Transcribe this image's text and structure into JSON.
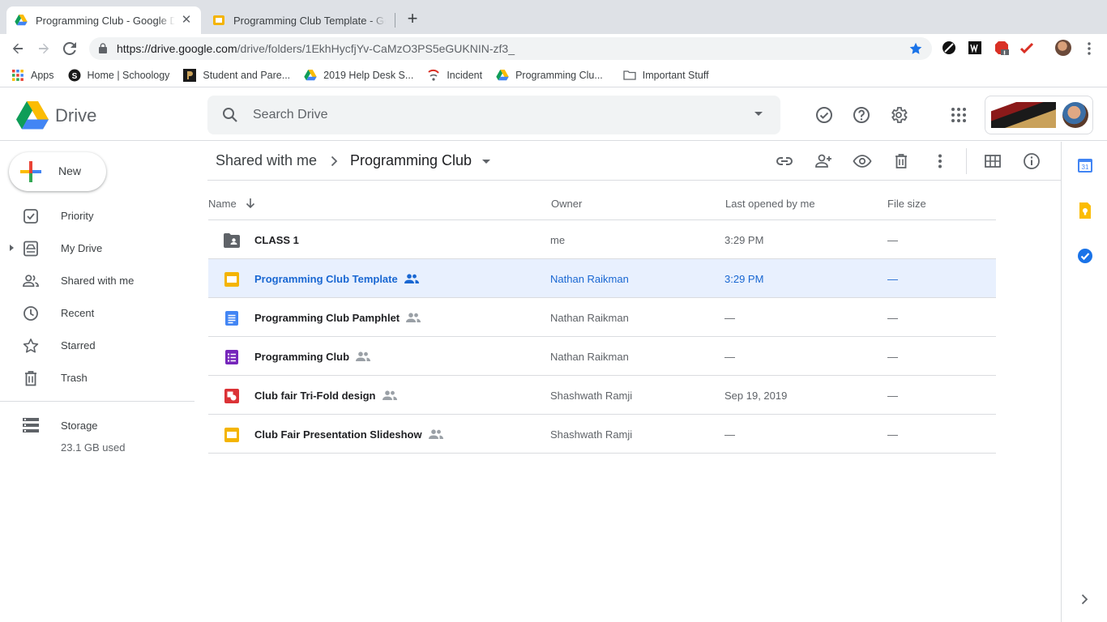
{
  "browser": {
    "tabs": [
      {
        "title": "Programming Club - Google Drive",
        "active": true
      },
      {
        "title": "Programming Club Template - Google Slides",
        "active": false
      }
    ],
    "url_host": "https://drive.google.com",
    "url_path": "/drive/folders/1EkhHycfjYv-CaMzO3PS5eGUKNIN-zf3_",
    "bookmarks": [
      "Apps",
      "Home | Schoology",
      "Student and Pare...",
      "2019 Help Desk S...",
      "Incident",
      "Programming Clu...",
      "Important Stuff"
    ]
  },
  "header": {
    "app_name": "Drive",
    "search_placeholder": "Search Drive"
  },
  "sidebar": {
    "new_label": "New",
    "items": [
      {
        "label": "Priority",
        "icon": "priority-icon"
      },
      {
        "label": "My Drive",
        "icon": "my-drive-icon"
      },
      {
        "label": "Shared with me",
        "icon": "shared-with-me-icon"
      },
      {
        "label": "Recent",
        "icon": "recent-icon"
      },
      {
        "label": "Starred",
        "icon": "star-icon"
      },
      {
        "label": "Trash",
        "icon": "trash-icon"
      }
    ],
    "storage_label": "Storage",
    "storage_used": "23.1 GB used"
  },
  "breadcrumb": {
    "parent": "Shared with me",
    "current": "Programming Club"
  },
  "table": {
    "columns": [
      "Name",
      "Owner",
      "Last opened by me",
      "File size"
    ],
    "rows": [
      {
        "name": "CLASS 1",
        "type": "shared-folder",
        "shared": false,
        "owner": "me",
        "last_opened": "3:29 PM",
        "size": "—",
        "selected": false
      },
      {
        "name": "Programming Club Template",
        "type": "slides",
        "shared": true,
        "owner": "Nathan Raikman",
        "last_opened": "3:29 PM",
        "size": "—",
        "selected": true
      },
      {
        "name": "Programming Club Pamphlet",
        "type": "docs",
        "shared": true,
        "owner": "Nathan Raikman",
        "last_opened": "—",
        "size": "—",
        "selected": false
      },
      {
        "name": "Programming Club",
        "type": "forms",
        "shared": true,
        "owner": "Nathan Raikman",
        "last_opened": "—",
        "size": "—",
        "selected": false
      },
      {
        "name": "Club fair Tri-Fold design",
        "type": "drawings",
        "shared": true,
        "owner": "Shashwath Ramji",
        "last_opened": "Sep 19, 2019",
        "size": "—",
        "selected": false
      },
      {
        "name": "Club Fair Presentation Slideshow",
        "type": "slides",
        "shared": true,
        "owner": "Shashwath Ramji",
        "last_opened": "—",
        "size": "—",
        "selected": false
      }
    ]
  },
  "rightpanel": {
    "calendar_day": "31"
  },
  "colors": {
    "selected_row_bg": "#e8f0fe",
    "selected_text": "#1967d2",
    "slides_yellow": "#f4b400",
    "docs_blue": "#4285f4",
    "forms_purple": "#7627bb",
    "drawings_red": "#db3236"
  }
}
